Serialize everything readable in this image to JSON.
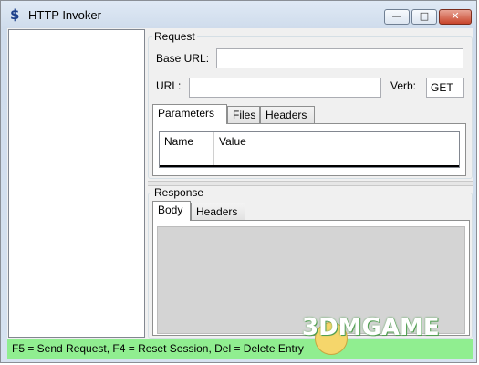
{
  "window": {
    "title": "HTTP Invoker",
    "icon": "dollar-swap-icon",
    "buttons": {
      "minimize": "—",
      "maximize": "□",
      "close": "✕"
    }
  },
  "request": {
    "group_title": "Request",
    "base_url_label": "Base URL:",
    "base_url_value": "",
    "url_label": "URL:",
    "url_value": "",
    "verb_label": "Verb:",
    "verb_value": "GET",
    "tabs": [
      "Parameters",
      "Files",
      "Headers"
    ],
    "active_tab": "Parameters",
    "grid_headers": [
      "Name",
      "Value"
    ]
  },
  "response": {
    "group_title": "Response",
    "tabs": [
      "Body",
      "Headers"
    ],
    "active_tab": "Body"
  },
  "statusbar": {
    "text": "F5 = Send Request, F4 = Reset Session, Del = Delete Entry"
  },
  "watermark": {
    "text": "3DMGAME"
  },
  "colors": {
    "statusbar_bg": "#90ee90",
    "body_area_bg": "#d4d4d4"
  }
}
